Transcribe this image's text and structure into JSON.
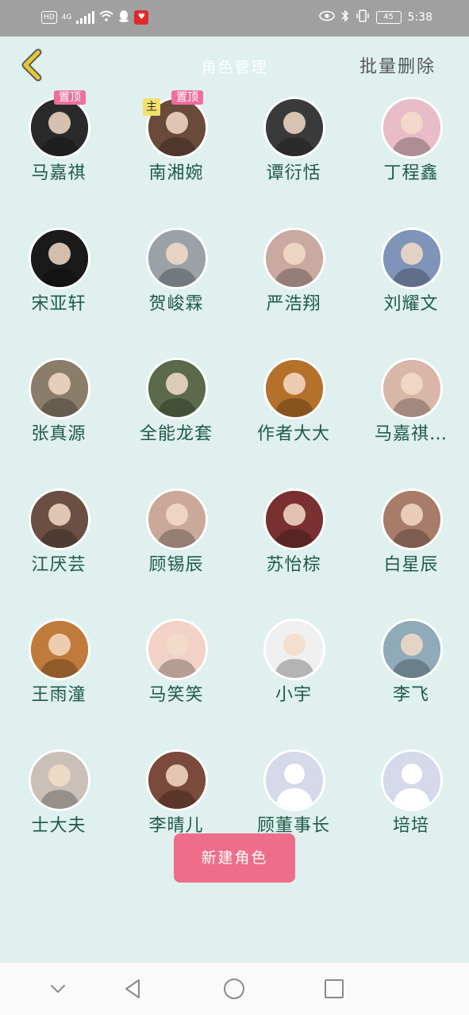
{
  "status_bar": {
    "hd": "HD",
    "network": "4G",
    "battery": "45",
    "time": "5:38"
  },
  "header": {
    "title": "角色管理",
    "batch_delete": "批量删除"
  },
  "tags": {
    "top": "置顶",
    "main": "主"
  },
  "characters": [
    {
      "name": "马嘉祺",
      "tag": "top",
      "bg": "#2a2a2a"
    },
    {
      "name": "南湘婉",
      "tag": "top",
      "main": true,
      "bg": "#6a4a3a"
    },
    {
      "name": "谭衍恬",
      "bg": "#3a3a3a"
    },
    {
      "name": "丁程鑫",
      "bg": "#e8bcc8"
    },
    {
      "name": "宋亚轩",
      "bg": "#1a1a1a"
    },
    {
      "name": "贺峻霖",
      "bg": "#9aa2a8"
    },
    {
      "name": "严浩翔",
      "bg": "#c9a9a0"
    },
    {
      "name": "刘耀文",
      "bg": "#7f94b8"
    },
    {
      "name": "张真源",
      "bg": "#8a7d6a"
    },
    {
      "name": "全能龙套",
      "bg": "#5b6a4a"
    },
    {
      "name": "作者大大",
      "bg": "#b5702a"
    },
    {
      "name": "马嘉祺…",
      "bg": "#d8b6a8"
    },
    {
      "name": "江厌芸",
      "bg": "#6a4f42"
    },
    {
      "name": "顾锡辰",
      "bg": "#caa99a"
    },
    {
      "name": "苏怡棕",
      "bg": "#7a3030"
    },
    {
      "name": "白星辰",
      "bg": "#a77c6a"
    },
    {
      "name": "王雨潼",
      "bg": "#c07a3a"
    },
    {
      "name": "马笑笑",
      "bg": "#f2d2c6"
    },
    {
      "name": "小宇",
      "bg": "#f0f0f0"
    },
    {
      "name": "李飞",
      "bg": "#8faab8"
    },
    {
      "name": "士大夫",
      "bg": "#c9c0b8"
    },
    {
      "name": "李晴儿",
      "bg": "#7a4a3a"
    },
    {
      "name": "顾董事长",
      "placeholder": true,
      "bg": "#d5d9ea"
    },
    {
      "name": "培培",
      "placeholder": true,
      "bg": "#d5d9ea"
    }
  ],
  "new_button": "新建角色",
  "colors": {
    "background": "#dff0ee",
    "accent": "#ee6d88",
    "name_text": "#1f5a46",
    "back_arrow": "#e8c832"
  }
}
